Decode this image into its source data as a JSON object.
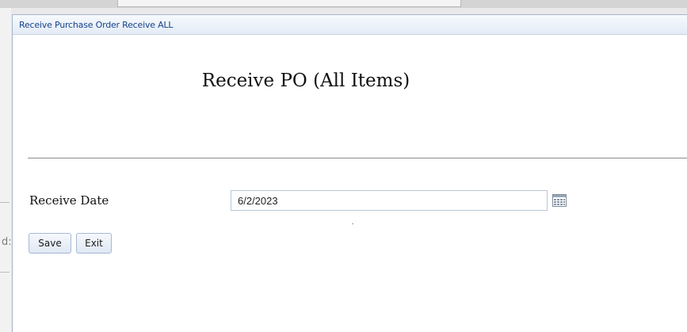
{
  "background": {
    "clipped_text": "d:"
  },
  "dialog": {
    "title": "Receive Purchase Order Receive ALL",
    "page_title": "Receive PO (All Items)",
    "form": {
      "receive_date_label": "Receive Date",
      "receive_date_value": "6/2/2023"
    },
    "buttons": {
      "save_label": "Save",
      "exit_label": "Exit"
    }
  },
  "icons": {
    "calendar": "calendar-icon"
  },
  "colors": {
    "titlebar_text": "#15428b",
    "border_accent": "#a6b6cd",
    "button_border": "#a6b9d3"
  }
}
